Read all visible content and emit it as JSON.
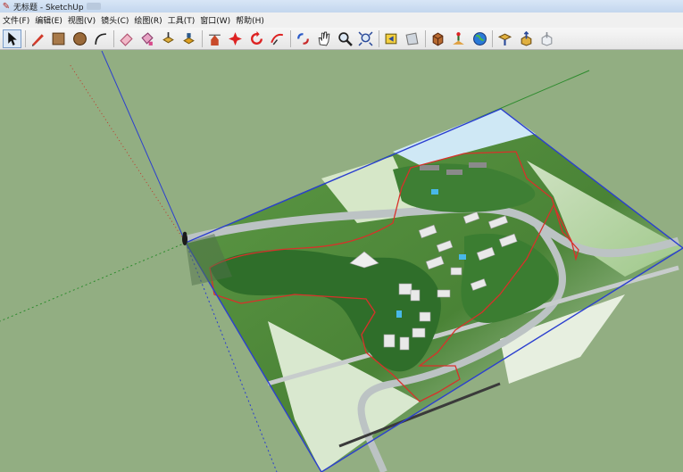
{
  "window": {
    "title": "无标题 - SketchUp"
  },
  "menu": {
    "items": [
      "文件(F)",
      "编辑(E)",
      "视图(V)",
      "镜头(C)",
      "绘图(R)",
      "工具(T)",
      "窗口(W)",
      "帮助(H)"
    ]
  },
  "toolbar": {
    "tools": [
      "select-icon",
      "pencil-line-icon",
      "rectangle-icon",
      "circle-icon",
      "arc-icon",
      "eraser-icon",
      "paint-bucket-icon",
      "push-pull-icon",
      "move-icon",
      "rotate-icon",
      "follow-me-icon",
      "offset-icon",
      "orbit-icon",
      "pan-icon",
      "zoom-icon",
      "zoom-extents-icon",
      "previous-view-icon",
      "next-view-icon",
      "get-models-icon",
      "add-location-icon",
      "google-earth-icon",
      "components-icon",
      "upload-icon",
      "share-icon"
    ]
  },
  "scene": {
    "background_color": "#92ae82",
    "axis_red": "#c0392b",
    "axis_green": "#2e8b2e",
    "axis_blue": "#2b3fcf",
    "boundary_red": "#d8312a",
    "ground_color": "#4f8a3a"
  }
}
